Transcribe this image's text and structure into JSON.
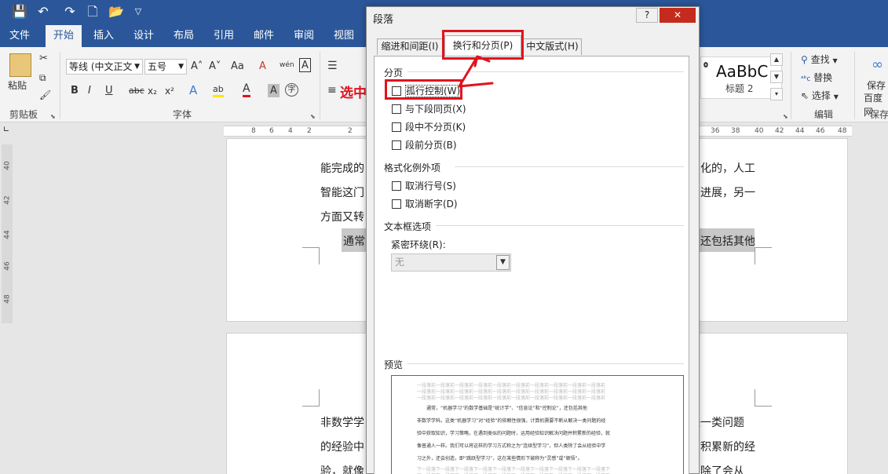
{
  "quick_access": {
    "save": "💾",
    "undo": "↶",
    "redo": "↷",
    "new": "🗋",
    "open": "📂",
    "customize": "▽"
  },
  "tabs": [
    "文件",
    "开始",
    "插入",
    "设计",
    "布局",
    "引用",
    "邮件",
    "审阅",
    "视图"
  ],
  "ribbon": {
    "paste_label": "粘贴",
    "clipboard_label": "剪贴板",
    "font_name": "等线 (中文正文",
    "font_size": "五号",
    "font_label": "字体",
    "grow": "A˄",
    "shrink": "A˅",
    "case": "Aa",
    "clear": "A",
    "phonetic": "wén",
    "border_char": "A",
    "bold": "B",
    "italic": "I",
    "underline": "U",
    "strike": "abc",
    "subscript": "x₂",
    "superscript": "x²",
    "text_effect": "A",
    "highlight": "ab",
    "font_color": "A",
    "shade": "A",
    "enclose": "字",
    "style_preview": "AaBbC",
    "style_name": "标题 2",
    "find": "查找",
    "replace": "替换",
    "select": "选择",
    "editing_label": "编辑",
    "save_label": "保存",
    "save_sub": "百度网",
    "save_group": "保存"
  },
  "annotation": {
    "select_text": "选中"
  },
  "ruler": {
    "left": [
      "8",
      "6",
      "4",
      "2",
      "2"
    ],
    "right": [
      "36",
      "38",
      "40",
      "42",
      "44",
      "46",
      "48"
    ],
    "vertical": [
      "40",
      "42",
      "44",
      "46",
      "48"
    ]
  },
  "document": {
    "lines_top": [
      {
        "left": "能完成的",
        "right": "化的，人工"
      },
      {
        "left": "智能这门",
        "right": "进展，另一"
      },
      {
        "left": "方面又转",
        "right": ""
      },
      {
        "left": "通常",
        "right": "还包括其他"
      }
    ],
    "lines_bottom": [
      {
        "left": "非数学学",
        "right": "决一类问题"
      },
      {
        "left": "的经验中",
        "right": "积累新的经"
      },
      {
        "left": "验，就像",
        "right": "类除了会从"
      }
    ]
  },
  "dialog": {
    "title": "段落",
    "help": "?",
    "close": "✕",
    "tabs": [
      "缩进和间距(I)",
      "换行和分页(P)",
      "中文版式(H)"
    ],
    "sections": {
      "pagination": "分页",
      "exceptions": "格式化例外项",
      "textbox": "文本框选项",
      "preview": "预览"
    },
    "checkboxes": {
      "widow": "孤行控制(W)",
      "keep_next": "与下段同页(X)",
      "keep_lines": "段中不分页(K)",
      "page_before": "段前分页(B)",
      "suppress_ln": "取消行号(S)",
      "no_hyphen": "取消断字(D)"
    },
    "tight_wrap_label": "紧密环绕(R):",
    "tight_wrap_value": "无",
    "preview_text": {
      "prev_para": "一段落前一段落前一段落前一段落前一段落前一段落前一段落前一段落前一段落前一段落前",
      "body": [
        "通常，“机器学习”的数学基础是“统计学”、“信息论”和“控制论”，还包括其他",
        "非数学学科。这类“机器学习”对“经验”的依赖性很强，计算机需要不断从解决一类问题的经",
        "验中获取知识，学习策略，在遇到类似的问题时，运用经验知识解决问题并积累新的经验，就",
        "像普通人一样。我们可以将这样的学习方式称之为“连续型学习”，但人类除了会从经验中学",
        "习之外，还会创造，即“跳跃型学习”，这在某些情形下被称为“灵感”或“顿悟”。"
      ],
      "next_para": "下一段落下一段落下一段落下一段落下一段落下一段落下一段落下一段落下一段落下一段落下"
    }
  },
  "colors": {
    "accent": "#2b579a",
    "annotation": "#e0141e"
  }
}
